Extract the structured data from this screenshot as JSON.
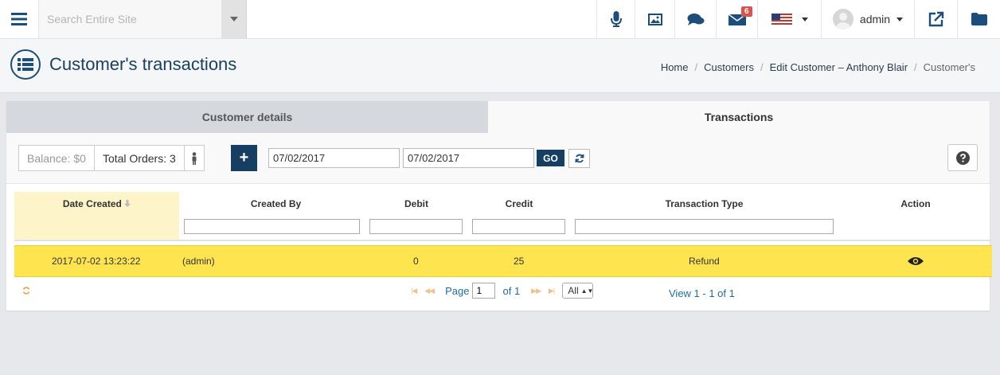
{
  "topbar": {
    "search_placeholder": "Search Entire Site",
    "mail_badge": "6",
    "user_name": "admin",
    "icons": [
      "menu-icon",
      "chevron-down-icon",
      "microphone-icon",
      "image-icon",
      "chat-icon",
      "envelope-icon",
      "us-flag-icon",
      "external-link-icon",
      "folder-icon"
    ]
  },
  "header": {
    "title": "Customer's transactions",
    "breadcrumb": [
      "Home",
      "Customers",
      "Edit Customer – Anthony Blair",
      "Customer's"
    ]
  },
  "tabs": {
    "details": "Customer details",
    "transactions": "Transactions"
  },
  "toolbar": {
    "balance": "Balance: $0",
    "total_orders": "Total Orders: 3",
    "add_label": "+",
    "date_from": "07/02/2017",
    "date_to": "07/02/2017",
    "go_label": "GO"
  },
  "grid": {
    "columns": [
      "Date Created",
      "Created By",
      "Debit",
      "Credit",
      "Transaction Type",
      "Action"
    ],
    "rows": [
      {
        "date_created": "2017-07-02 13:23:22",
        "created_by": "(admin)",
        "debit": "0",
        "credit": "25",
        "transaction_type": "Refund"
      }
    ]
  },
  "pager": {
    "page_label": "Page",
    "page_value": "1",
    "of_label": "of 1",
    "rows_option": "All",
    "view_info": "View 1 - 1 of 1"
  },
  "colors": {
    "brand_navy": "#163e63",
    "row_highlight": "#fee44f",
    "sorted_column": "#fdf4c9",
    "badge_red": "#d9534f",
    "link_blue": "#1d6fa8"
  }
}
